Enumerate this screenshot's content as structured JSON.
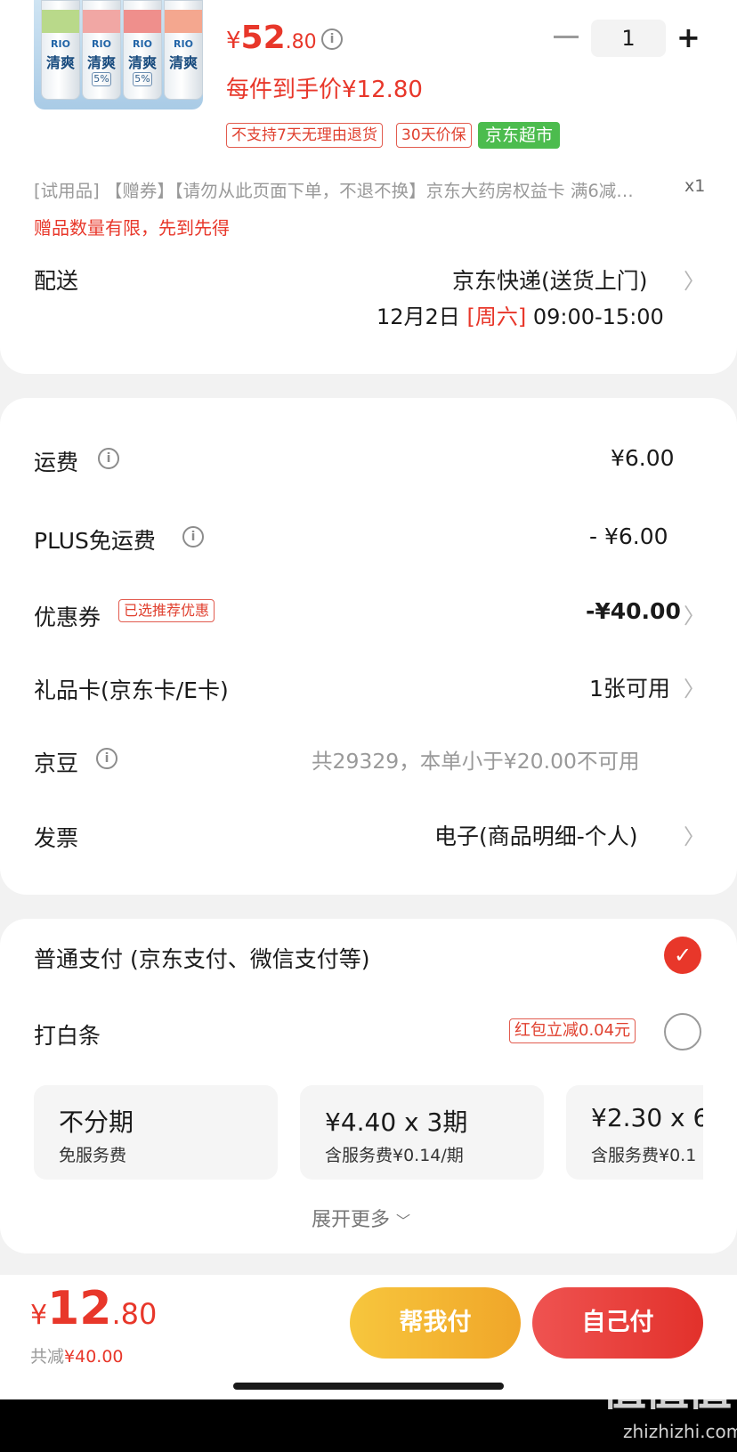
{
  "product": {
    "image_brand": "RIO",
    "image_name": "清爽",
    "image_pct": "5%",
    "price_symbol": "¥",
    "price_int": "52",
    "price_dec": ".80",
    "per_item": "每件到手价¥12.80",
    "quantity": "1",
    "tags": [
      "不支持7天无理由退货",
      "30天价保"
    ],
    "store_tag": "京东超市",
    "gift_line": "[试用品]  【赠券】【请勿从此页面下单，不退不换】京东大药房权益卡 满6减…",
    "gift_qty": "x1",
    "gift_note": "赠品数量有限，先到先得"
  },
  "delivery": {
    "label": "配送",
    "method": "京东快递(送货上门)",
    "date": "12月2日",
    "weekday": "[周六]",
    "time": "09:00-15:00"
  },
  "fees": {
    "shipping": {
      "label": "运费",
      "value": "¥6.00"
    },
    "plus": {
      "label": "PLUS免运费",
      "value": "- ¥6.00"
    },
    "coupon": {
      "label": "优惠券",
      "badge": "已选推荐优惠",
      "value": "-¥40.00"
    },
    "giftcard": {
      "label": "礼品卡(京东卡/E卡)",
      "value": "1张可用"
    },
    "jingdou": {
      "label": "京豆",
      "value": "共29329，本单小于¥20.00不可用"
    },
    "invoice": {
      "label": "发票",
      "value": "电子(商品明细-个人)"
    }
  },
  "payment": {
    "normal": "普通支付 (京东支付、微信支付等)",
    "baitiao": "打白条",
    "baitiao_badge": "红包立减0.04元",
    "plans": [
      {
        "title": "不分期",
        "sub": "免服务费"
      },
      {
        "title": "¥4.40 x 3期",
        "sub": "含服务费¥0.14/期"
      },
      {
        "title": "¥2.30 x 6",
        "sub": "含服务费¥0.1"
      }
    ],
    "expand": "展开更多"
  },
  "bottom": {
    "total_symbol": "¥",
    "total_int": "12",
    "total_dec": ".80",
    "saved_label": "共减",
    "saved_value": "¥40.00",
    "help_pay": "帮我付",
    "self_pay": "自己付"
  },
  "watermark": {
    "logo": "值值值",
    "url": "zhizhizhi.com"
  },
  "colors": {
    "accent_red": "#e8372a",
    "green_tag": "#4cbc4e",
    "help_btn": "#f2b431"
  }
}
